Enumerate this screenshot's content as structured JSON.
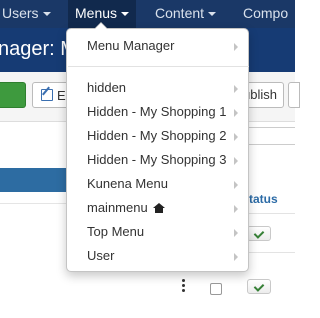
{
  "navbar": {
    "items": [
      {
        "label": "Users"
      },
      {
        "label": "Menus"
      },
      {
        "label": "Content"
      },
      {
        "label": "Compo"
      }
    ]
  },
  "page": {
    "title": "nager: M"
  },
  "toolbar": {
    "edit_label": "E",
    "publish_label": "ublish"
  },
  "table": {
    "status_header": "tatus"
  },
  "dropdown": {
    "items": [
      {
        "label": "Menu Manager"
      },
      {
        "label": "hidden"
      },
      {
        "label": "Hidden - My Shopping 1"
      },
      {
        "label": "Hidden - My Shopping 2"
      },
      {
        "label": "Hidden - My Shopping 3"
      },
      {
        "label": "Kunena Menu"
      },
      {
        "label": "mainmenu"
      },
      {
        "label": "Top Menu"
      },
      {
        "label": "User"
      }
    ]
  },
  "colors": {
    "navbar": "#1a3867",
    "subheader": "#163b74",
    "accent": "#2d6ca2",
    "success": "#3e9a3e"
  },
  "icons": {
    "home": "home-icon",
    "check": "check-icon",
    "edit": "edit-icon",
    "submenu": "chevron-right-icon"
  }
}
